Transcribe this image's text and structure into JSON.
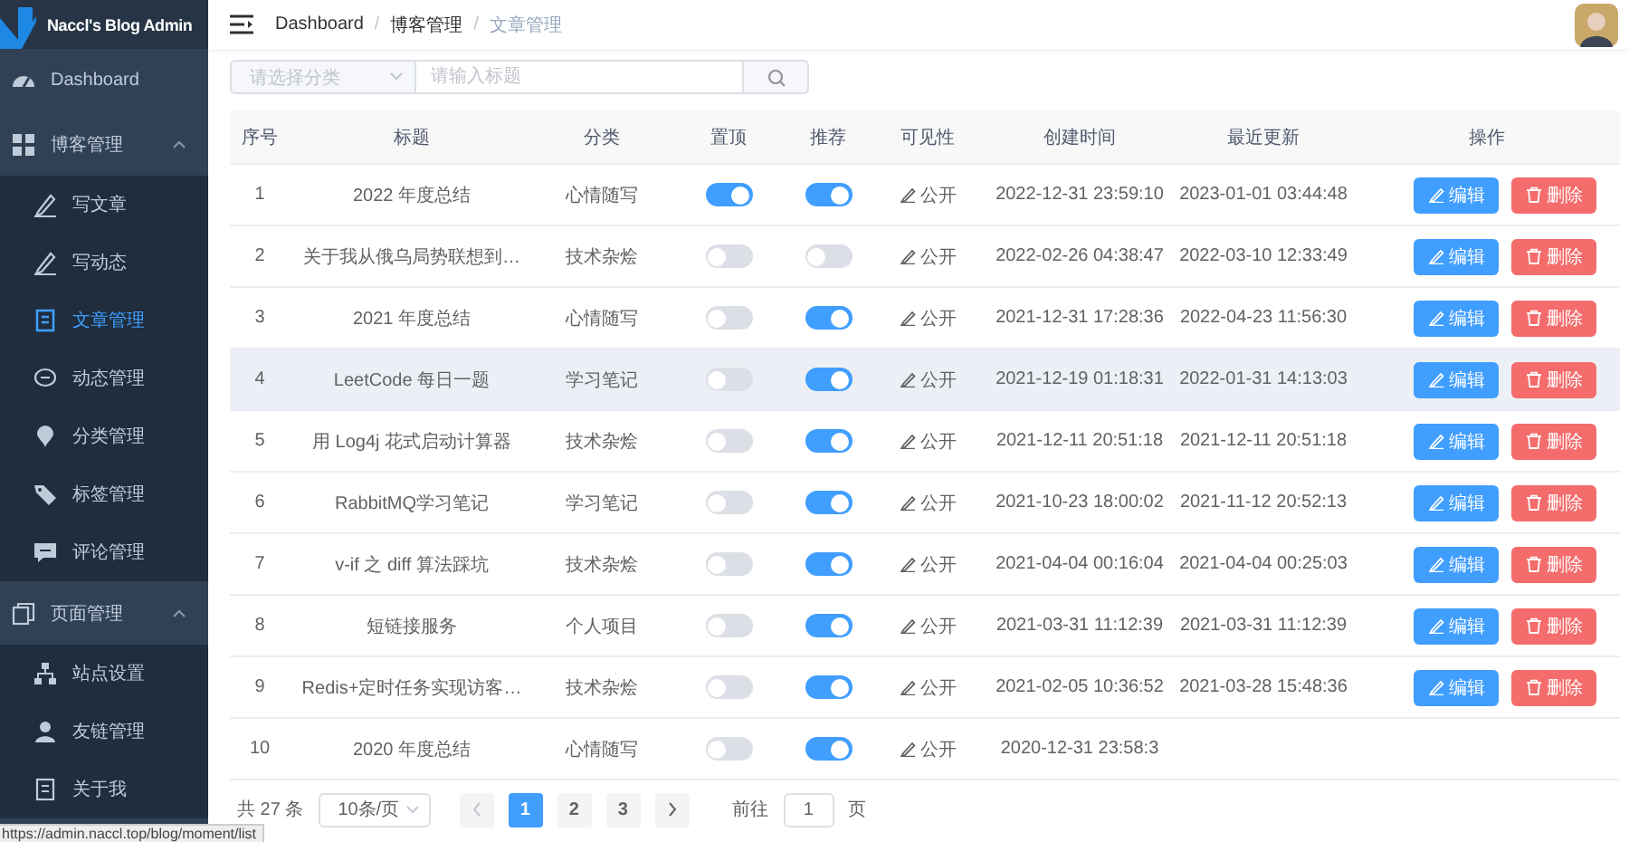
{
  "logo": {
    "title": "Naccl's Blog Admin"
  },
  "sidebar": {
    "items": [
      {
        "label": "Dashboard",
        "kind": "link",
        "selected": false
      },
      {
        "label": "博客管理",
        "kind": "group",
        "expanded": true,
        "children": [
          {
            "label": "写文章",
            "selected": false
          },
          {
            "label": "写动态",
            "selected": false
          },
          {
            "label": "文章管理",
            "selected": true
          },
          {
            "label": "动态管理",
            "selected": false
          },
          {
            "label": "分类管理",
            "selected": false
          },
          {
            "label": "标签管理",
            "selected": false
          },
          {
            "label": "评论管理",
            "selected": false
          }
        ]
      },
      {
        "label": "页面管理",
        "kind": "group",
        "expanded": true,
        "children": [
          {
            "label": "站点设置",
            "selected": false
          },
          {
            "label": "友链管理",
            "selected": false
          },
          {
            "label": "关于我",
            "selected": false
          }
        ]
      }
    ]
  },
  "breadcrumb": {
    "separator": "/",
    "items": [
      "Dashboard",
      "博客管理",
      "文章管理"
    ]
  },
  "filter": {
    "category_placeholder": "请选择分类",
    "title_placeholder": "请输入标题"
  },
  "table": {
    "columns": [
      "序号",
      "标题",
      "分类",
      "置顶",
      "推荐",
      "可见性",
      "创建时间",
      "最近更新",
      "操作"
    ],
    "rows": [
      {
        "index": "1",
        "title": "2022 年度总结",
        "category": "心情随写",
        "top": true,
        "recommend": true,
        "visibility": "公开",
        "created": "2022-12-31 23:59:10",
        "updated": "2023-01-01 03:44:48",
        "actions": [
          {
            "kind": "edit",
            "label": "编辑"
          },
          {
            "kind": "delete",
            "label": "删除"
          }
        ],
        "hovered": false
      },
      {
        "index": "2",
        "title": "关于我从俄乌局势联想到…",
        "category": "技术杂烩",
        "top": false,
        "recommend": false,
        "visibility": "公开",
        "created": "2022-02-26 04:38:47",
        "updated": "2022-03-10 12:33:49",
        "actions": [
          {
            "kind": "edit",
            "label": "编辑"
          },
          {
            "kind": "delete",
            "label": "删除"
          }
        ],
        "hovered": false
      },
      {
        "index": "3",
        "title": "2021 年度总结",
        "category": "心情随写",
        "top": false,
        "recommend": true,
        "visibility": "公开",
        "created": "2021-12-31 17:28:36",
        "updated": "2022-04-23 11:56:30",
        "actions": [
          {
            "kind": "edit",
            "label": "编辑"
          },
          {
            "kind": "delete",
            "label": "删除"
          }
        ],
        "hovered": false
      },
      {
        "index": "4",
        "title": "LeetCode 每日一题",
        "category": "学习笔记",
        "top": false,
        "recommend": true,
        "visibility": "公开",
        "created": "2021-12-19 01:18:31",
        "updated": "2022-01-31 14:13:03",
        "actions": [
          {
            "kind": "edit",
            "label": "编辑"
          },
          {
            "kind": "delete",
            "label": "删除"
          }
        ],
        "hovered": true
      },
      {
        "index": "5",
        "title": "用 Log4j 花式启动计算器",
        "category": "技术杂烩",
        "top": false,
        "recommend": true,
        "visibility": "公开",
        "created": "2021-12-11 20:51:18",
        "updated": "2021-12-11 20:51:18",
        "actions": [
          {
            "kind": "edit",
            "label": "编辑"
          },
          {
            "kind": "delete",
            "label": "删除"
          }
        ],
        "hovered": false
      },
      {
        "index": "6",
        "title": "RabbitMQ学习笔记",
        "category": "学习笔记",
        "top": false,
        "recommend": true,
        "visibility": "公开",
        "created": "2021-10-23 18:00:02",
        "updated": "2021-11-12 20:52:13",
        "actions": [
          {
            "kind": "edit",
            "label": "编辑"
          },
          {
            "kind": "delete",
            "label": "删除"
          }
        ],
        "hovered": false
      },
      {
        "index": "7",
        "title": "v-if 之 diff 算法踩坑",
        "category": "技术杂烩",
        "top": false,
        "recommend": true,
        "visibility": "公开",
        "created": "2021-04-04 00:16:04",
        "updated": "2021-04-04 00:25:03",
        "actions": [
          {
            "kind": "edit",
            "label": "编辑"
          },
          {
            "kind": "delete",
            "label": "删除"
          }
        ],
        "hovered": false
      },
      {
        "index": "8",
        "title": "短链接服务",
        "category": "个人项目",
        "top": false,
        "recommend": true,
        "visibility": "公开",
        "created": "2021-03-31 11:12:39",
        "updated": "2021-03-31 11:12:39",
        "actions": [
          {
            "kind": "edit",
            "label": "编辑"
          },
          {
            "kind": "delete",
            "label": "删除"
          }
        ],
        "hovered": false
      },
      {
        "index": "9",
        "title": "Redis+定时任务实现访客…",
        "category": "技术杂烩",
        "top": false,
        "recommend": true,
        "visibility": "公开",
        "created": "2021-02-05 10:36:52",
        "updated": "2021-03-28 15:48:36",
        "actions": [
          {
            "kind": "edit",
            "label": "编辑"
          },
          {
            "kind": "delete",
            "label": "删除"
          }
        ],
        "hovered": false
      },
      {
        "index": "10",
        "title": "2020 年度总结",
        "category": "心情随写",
        "top": false,
        "recommend": true,
        "visibility": "公开",
        "created": "2020-12-31 23:58:3",
        "hovered": false
      }
    ]
  },
  "pagination": {
    "total": "共 27 条",
    "page_size": "10条/页",
    "pages": [
      {
        "label": "1",
        "selected": true
      },
      {
        "label": "2",
        "selected": false
      },
      {
        "label": "3",
        "selected": false
      }
    ],
    "goto_label": "前往",
    "goto_value": "1",
    "goto_suffix": "页"
  },
  "status_url": "https://admin.naccl.top/blog/moment/list"
}
